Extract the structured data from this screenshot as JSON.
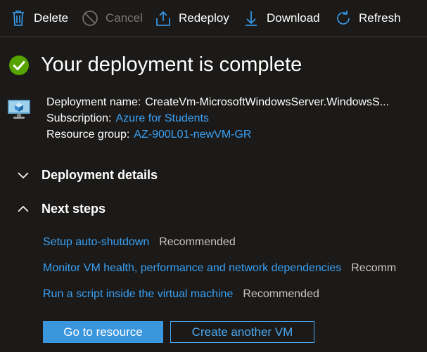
{
  "toolbar": {
    "delete_label": "Delete",
    "cancel_label": "Cancel",
    "redeploy_label": "Redeploy",
    "download_label": "Download",
    "refresh_label": "Refresh"
  },
  "header": {
    "title": "Your deployment is complete"
  },
  "deployment": {
    "name_label": "Deployment name:",
    "name_value": "CreateVm-MicrosoftWindowsServer.WindowsS...",
    "subscription_label": "Subscription:",
    "subscription_value": "Azure for Students",
    "resource_group_label": "Resource group:",
    "resource_group_value": "AZ-900L01-newVM-GR"
  },
  "sections": {
    "details_label": "Deployment details",
    "next_steps_label": "Next steps"
  },
  "next_steps": [
    {
      "link": "Setup auto-shutdown",
      "tag": "Recommended"
    },
    {
      "link": "Monitor VM health, performance and network dependencies",
      "tag": "Recomm"
    },
    {
      "link": "Run a script inside the virtual machine",
      "tag": "Recommended"
    }
  ],
  "actions": {
    "primary_label": "Go to resource",
    "secondary_label": "Create another VM"
  },
  "colors": {
    "background": "#1b1a19",
    "link": "#3aa0f3",
    "success": "#57a300",
    "primary_button": "#3a96dd"
  },
  "icons": {
    "delete": "trash-icon",
    "cancel": "cancel-circle-icon",
    "redeploy": "upload-icon",
    "download": "download-icon",
    "refresh": "refresh-icon",
    "status": "success-check-icon",
    "resource": "virtual-machine-icon"
  }
}
